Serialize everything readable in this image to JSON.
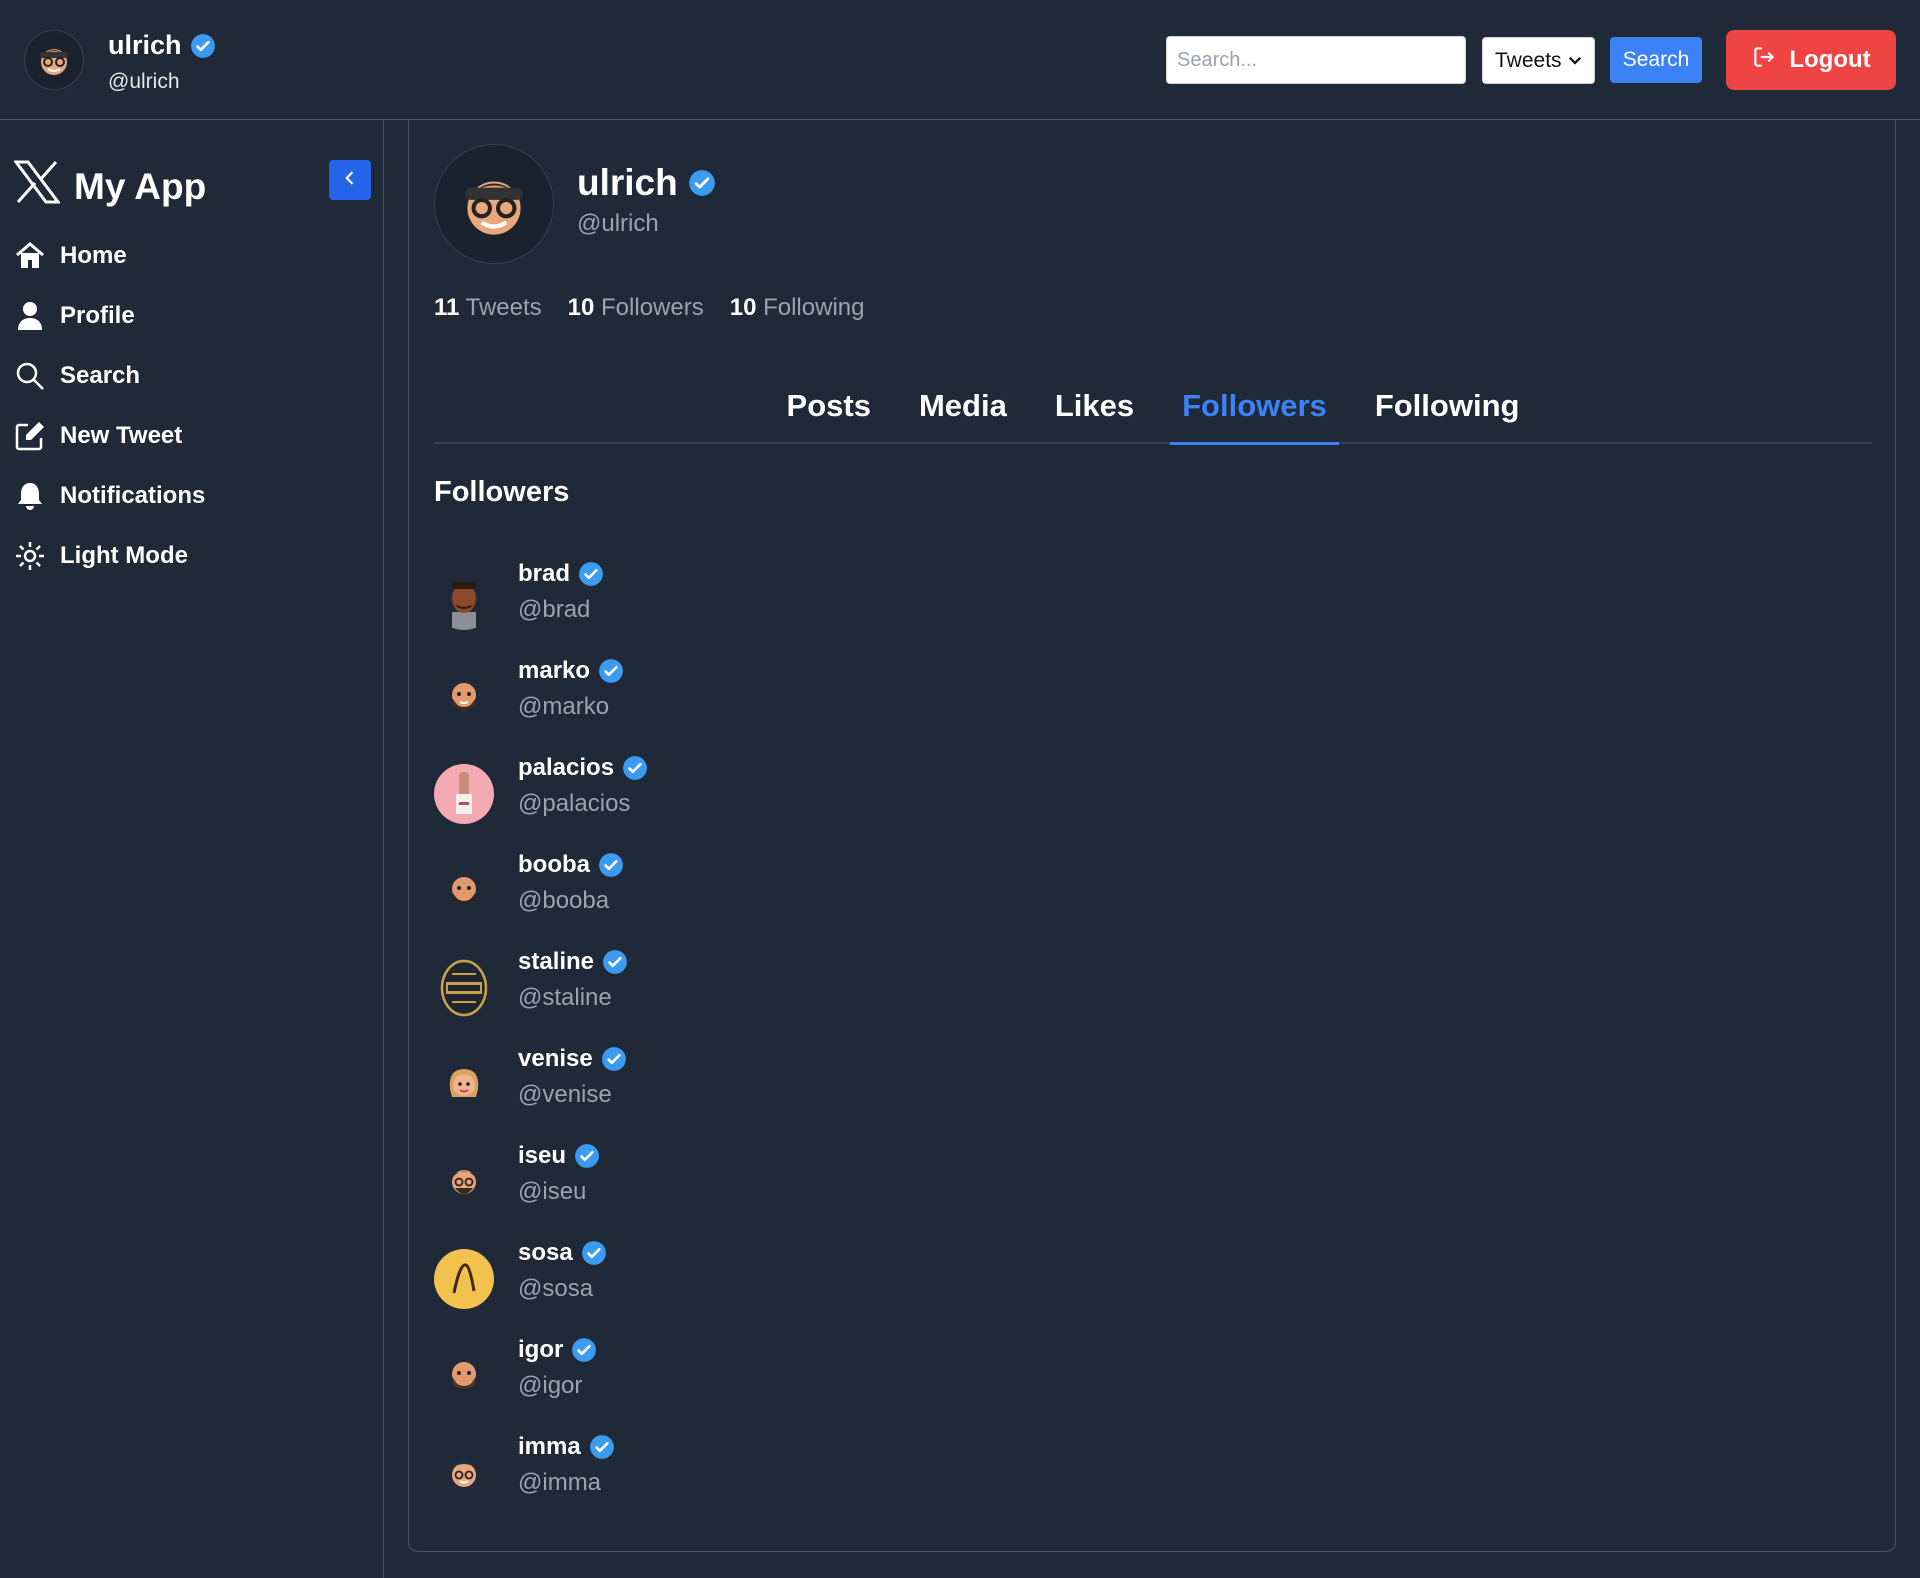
{
  "header": {
    "user_name": "ulrich",
    "user_handle": "@ulrich",
    "search_placeholder": "Search...",
    "search_type_selected": "Tweets",
    "search_button_label": "Search",
    "logout_label": "Logout"
  },
  "sidebar": {
    "brand": "My App",
    "items": [
      {
        "label": "Home",
        "icon": "home-icon"
      },
      {
        "label": "Profile",
        "icon": "user-icon"
      },
      {
        "label": "Search",
        "icon": "search-icon"
      },
      {
        "label": "New Tweet",
        "icon": "edit-icon"
      },
      {
        "label": "Notifications",
        "icon": "bell-icon"
      },
      {
        "label": "Light Mode",
        "icon": "sun-icon"
      }
    ]
  },
  "profile": {
    "name": "ulrich",
    "handle": "@ulrich",
    "stats": [
      {
        "value": "11",
        "label": "Tweets"
      },
      {
        "value": "10",
        "label": "Followers"
      },
      {
        "value": "10",
        "label": "Following"
      }
    ]
  },
  "tabs": [
    {
      "label": "Posts",
      "active": false
    },
    {
      "label": "Media",
      "active": false
    },
    {
      "label": "Likes",
      "active": false
    },
    {
      "label": "Followers",
      "active": true
    },
    {
      "label": "Following",
      "active": false
    }
  ],
  "followers_section": {
    "title": "Followers",
    "items": [
      {
        "name": "brad",
        "handle": "@brad",
        "avatar": "photo"
      },
      {
        "name": "marko",
        "handle": "@marko",
        "avatar": "memoji"
      },
      {
        "name": "palacios",
        "handle": "@palacios",
        "avatar": "pink"
      },
      {
        "name": "booba",
        "handle": "@booba",
        "avatar": "memoji"
      },
      {
        "name": "staline",
        "handle": "@staline",
        "avatar": "emblem"
      },
      {
        "name": "venise",
        "handle": "@venise",
        "avatar": "memoji-blonde"
      },
      {
        "name": "iseu",
        "handle": "@iseu",
        "avatar": "memoji-glasses"
      },
      {
        "name": "sosa",
        "handle": "@sosa",
        "avatar": "yellow"
      },
      {
        "name": "igor",
        "handle": "@igor",
        "avatar": "memoji"
      },
      {
        "name": "imma",
        "handle": "@imma",
        "avatar": "memoji-cap"
      }
    ]
  },
  "colors": {
    "background": "#1f2937",
    "border": "#4b5563",
    "accent": "#3b82f6",
    "verified": "#3b9bf0",
    "logout": "#ef4444",
    "muted_text": "#9ca3af"
  }
}
